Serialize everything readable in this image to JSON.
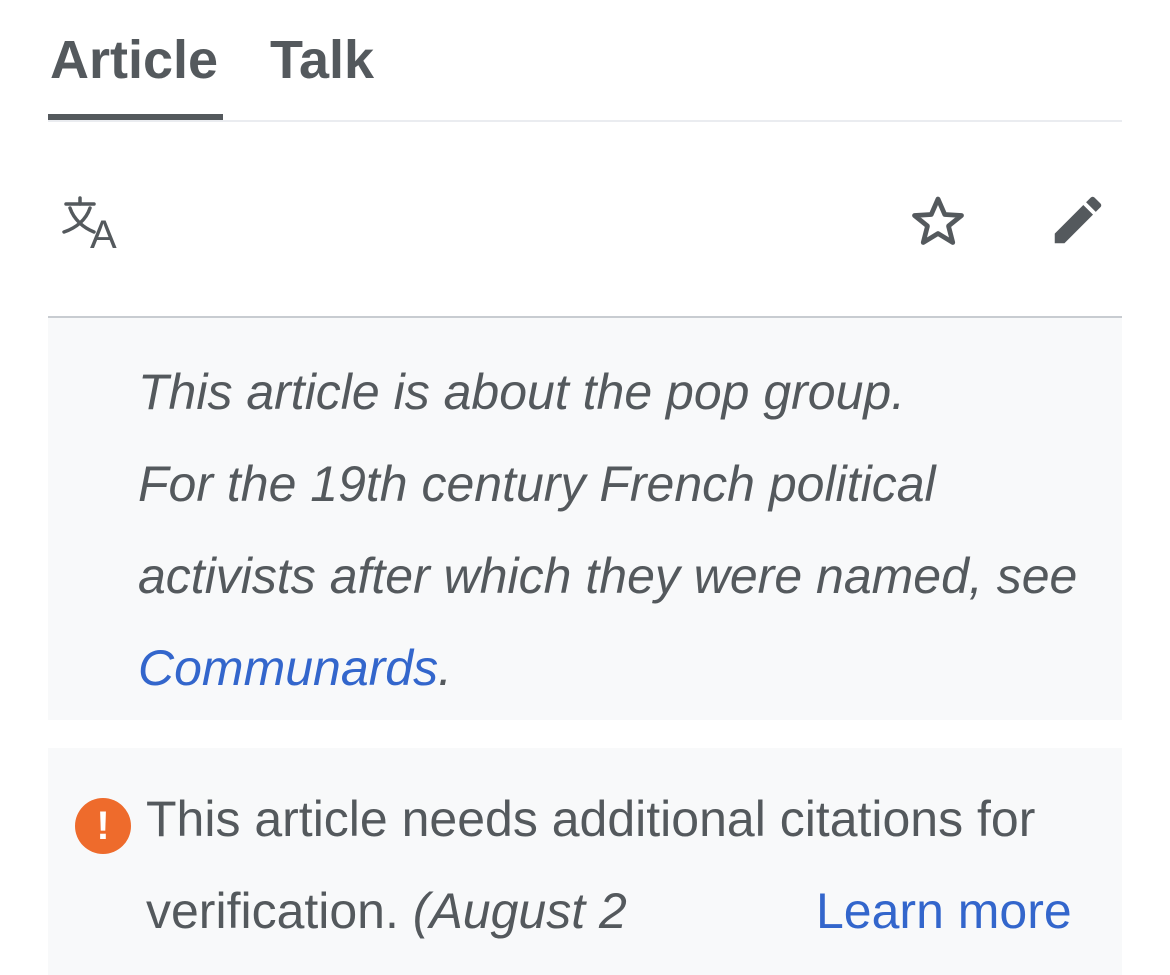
{
  "tabs": [
    {
      "label": "Article",
      "selected": true
    },
    {
      "label": "Talk",
      "selected": false
    }
  ],
  "toolbar": {
    "icons": [
      "language-icon",
      "star-icon",
      "edit-pencil-icon"
    ]
  },
  "hatnote": {
    "line1": "This article is about the pop group.",
    "line2_prefix": "For the 19th century French political activists after which they were named, see ",
    "link": "Communards",
    "suffix": "."
  },
  "notice": {
    "icon": "exclamation-icon",
    "icon_color": "#ee6b2c",
    "text": "This article needs additional citations for verification.",
    "date": "(August 2",
    "learn_more": "Learn more"
  },
  "colors": {
    "link": "#3366cc",
    "text": "#54595d",
    "panel_bg": "#f8f9fa"
  }
}
